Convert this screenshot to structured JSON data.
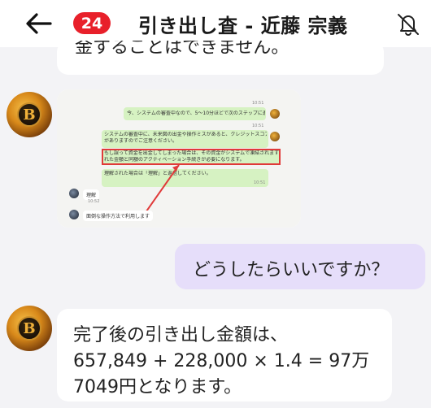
{
  "header": {
    "unread_count": "24",
    "title": "引き出し査 - 近藤 宗義"
  },
  "messages": {
    "top_partial": "金することはできません。",
    "image_screenshot": {
      "line1": "今、システムの審査中なので、5〜10分ほどで次のステップに進む予定です。",
      "time1": "10:51",
      "line2a": "システムの審査中に、未来図の出金や操作ミスがあると、クレジットスコアが下がる可能性",
      "line2b": "がありますのでご注意ください。",
      "time2": "10:51",
      "line3a": "もし誤って資金を出金してしまった場合は、その資金がシステムで凍結されますので、出金さ",
      "line3b": "れた金額と同額のアクティベーション手続きが必要になります。",
      "line4": "理解された場合は「理解」と返信してください。",
      "time4": "10:51",
      "reply1": "理解",
      "reply1_time": "10:52",
      "reply2": "面倒な操作方法で利用します"
    },
    "question": "どうしたらいいですか？",
    "answer_line1": "完了後の引き出し金額は、",
    "answer_line2": "657,849 + 228,000 × 1.4 = 97万",
    "answer_line3": "7049円となります。"
  },
  "icons": {
    "back": "back-arrow-icon",
    "mute": "bell-off-icon",
    "avatar": "bitcoin-avatar"
  },
  "colors": {
    "badge": "#e8202a",
    "question_bubble": "#e6defa",
    "highlight": "#e03a3a"
  }
}
